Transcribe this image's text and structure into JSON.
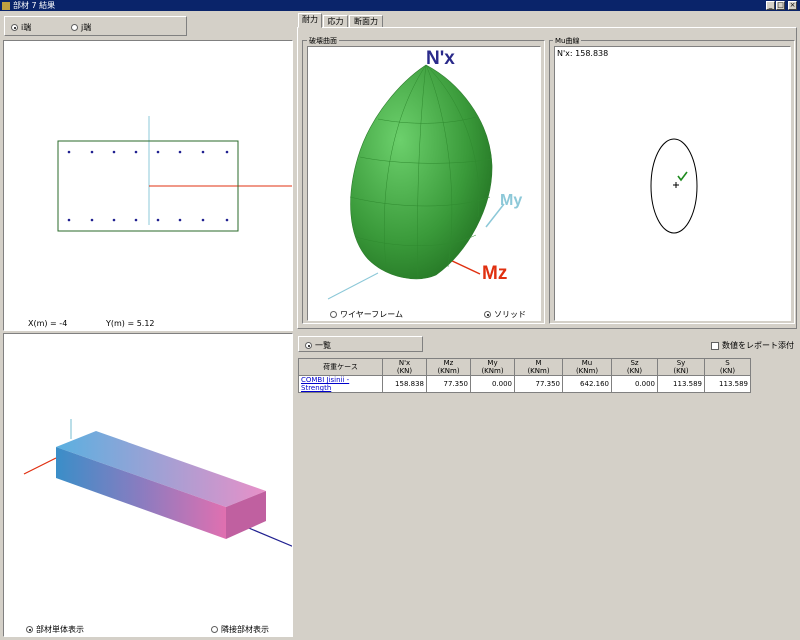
{
  "window": {
    "title": "部材 7 結果",
    "min": "_",
    "max": "□",
    "close": "×"
  },
  "left": {
    "radio_i": "i端",
    "radio_j": "j端",
    "coord_x": "X(m) = -4",
    "coord_y": "Y(m) = 5.12",
    "view_single": "部材単体表示",
    "view_adjacent": "隣接部材表示"
  },
  "tabs": [
    "耐力",
    "応力",
    "断面力"
  ],
  "surface": {
    "group": "破壊曲面",
    "axis_nx": "N'x",
    "axis_my": "My",
    "axis_mz": "Mz",
    "wireframe": "ワイヤーフレーム",
    "solid": "ソリッド"
  },
  "mu": {
    "group": "Mu曲線",
    "readout": "N'x: 158.838"
  },
  "list": {
    "radio": "一覧",
    "report_check": "数値をレポート添付"
  },
  "table": {
    "headers": [
      {
        "top": "荷重ケース",
        "bot": ""
      },
      {
        "top": "N'x",
        "bot": "(KN)"
      },
      {
        "top": "Mz",
        "bot": "(KNm)"
      },
      {
        "top": "My",
        "bot": "(KNm)"
      },
      {
        "top": "M",
        "bot": "(KNm)"
      },
      {
        "top": "Mu",
        "bot": "(KNm)"
      },
      {
        "top": "Sz",
        "bot": "(KN)"
      },
      {
        "top": "Sy",
        "bot": "(KN)"
      },
      {
        "top": "S",
        "bot": "(KN)"
      }
    ],
    "rows": [
      [
        "COMBI Jisinii - Strength",
        "158.838",
        "77.350",
        "0.000",
        "77.350",
        "642.160",
        "0.000",
        "113.589",
        "113.589"
      ]
    ]
  },
  "colors": {
    "titlebar": "#0a246a",
    "surface_green": "#3f9f3f",
    "mz_red": "#e03010",
    "nx_blue": "#2a2a8a",
    "my_cyan": "#8cc8d8"
  }
}
